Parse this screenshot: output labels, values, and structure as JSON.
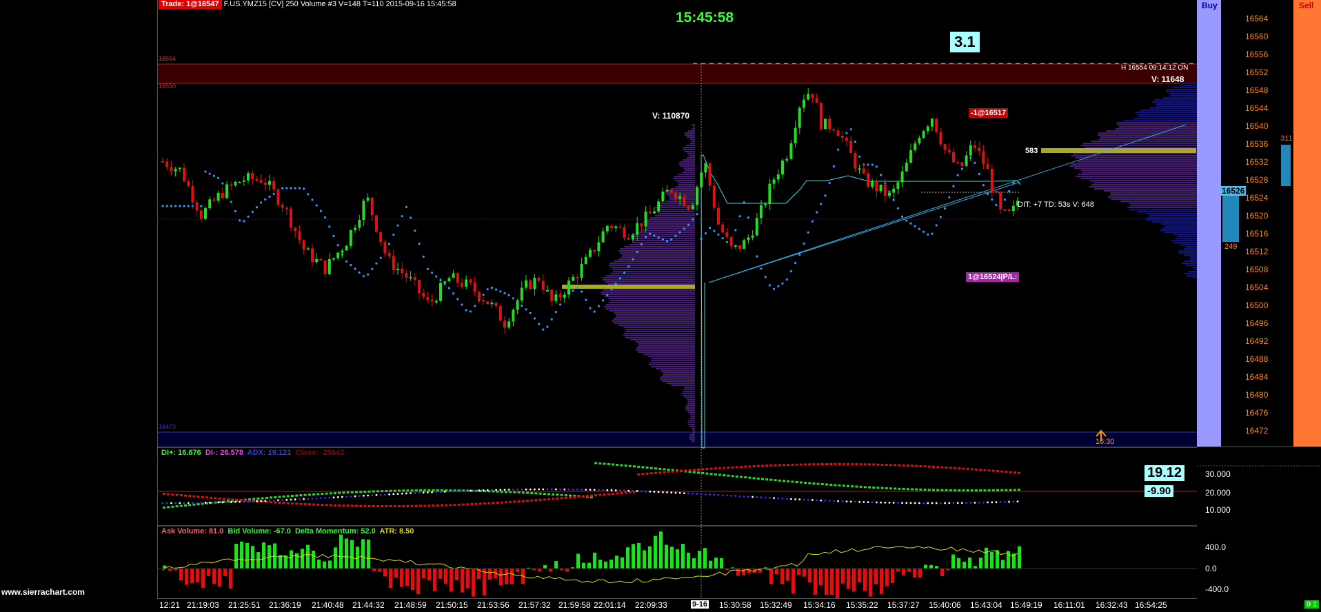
{
  "app": {
    "brand": "www.sierrachart.com",
    "trade_badge": "Trade: 1@16547",
    "title": "F.US.YMZ15 [CV]  250 Volume  #3 V=148 T=110 2015-09-16 15:45:58",
    "clock": "15:45:58",
    "score": "3.1",
    "buy_label": "Buy",
    "sell_label": "Sell"
  },
  "annotations": {
    "high_pre": "H 16554  09:14:12  ON",
    "v_top": "V: 11648",
    "v_mid": "V: 110870",
    "dit": "DIT: +7  TD: 53s  V: 648",
    "pos_label": "1@16524|P/L:",
    "neg_label": "-1@16517",
    "l583": "583",
    "current_price": "16526",
    "ladder_top": "311",
    "ladder_bottom": "249",
    "zone_time": "16:30",
    "level_16554": "16554",
    "level_16550": "16550",
    "level_16473": "16473"
  },
  "price_axis": [
    "16564",
    "16560",
    "16556",
    "16552",
    "16548",
    "16544",
    "16540",
    "16536",
    "16532",
    "16528",
    "16524",
    "16520",
    "16516",
    "16512",
    "16508",
    "16504",
    "16500",
    "16496",
    "16492",
    "16488",
    "16484",
    "16480",
    "16476",
    "16472"
  ],
  "indicator1": {
    "di_plus": "DI+: 16.676",
    "di_minus": "DI-: 26.578",
    "adx": "ADX: 19.121",
    "close": "Close: -25642",
    "value_main": "19.12",
    "value_sub": "-9.90",
    "ticks": [
      "30.000",
      "20.000",
      "10.000"
    ]
  },
  "indicator2": {
    "ask": "Ask Volume: 81.0",
    "bid": "Bid Volume: -67.0",
    "delta": "Delta Momentum: 52.0",
    "atr": "ATR: 8.50",
    "ticks": [
      "400.0",
      "0.0",
      "-400.0"
    ]
  },
  "time_axis": [
    "12:21",
    "21:19:03",
    "21:25:51",
    "21:36:19",
    "21:40:48",
    "21:44:32",
    "21:48:59",
    "21:50:15",
    "21:53:56",
    "21:57:32",
    "21:59:58",
    "22:01:14",
    "22:09:33",
    "9-16",
    "15:30:58",
    "15:32:49",
    "15:34:16",
    "15:35:22",
    "15:37:27",
    "15:40:06",
    "15:43:04",
    "15:49:19",
    "16:11:01",
    "16:32:43",
    "16:54:25"
  ],
  "corner": "9 1",
  "colors": {
    "up": "#22dd22",
    "down": "#dd1111",
    "dots": "#3399ff",
    "profile": "#4a1a7a",
    "profile_right": "#111188",
    "level_line": "#aaaa22",
    "buy": "#9999ff",
    "sell": "#ff7733"
  }
}
